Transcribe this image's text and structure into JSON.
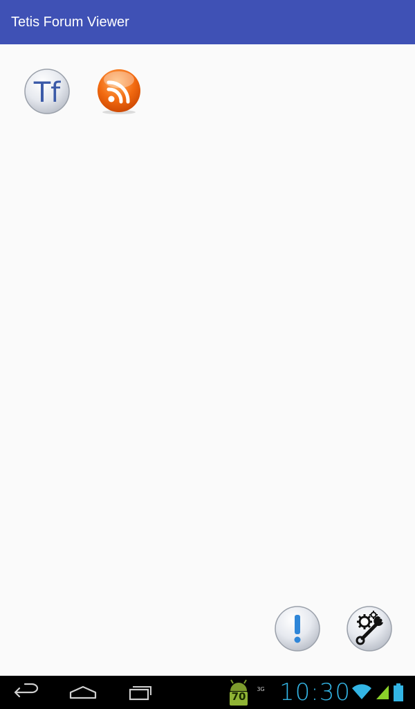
{
  "app_bar": {
    "title": "Tetis Forum Viewer",
    "color": "#3f51b5"
  },
  "main": {
    "buttons": [
      {
        "name": "tf-logo-button",
        "icon": "tf-logo-icon",
        "label": "Tf"
      },
      {
        "name": "rss-feed-button",
        "icon": "rss-icon"
      },
      {
        "name": "info-button",
        "icon": "exclamation-icon"
      },
      {
        "name": "settings-button",
        "icon": "wrench-gear-icon"
      }
    ]
  },
  "nav_bar": {
    "back_icon": "back-icon",
    "home_icon": "home-icon",
    "recent_icon": "recent-apps-icon"
  },
  "status_bar": {
    "notification_badge": "70",
    "network_type": "3G",
    "time": "10:30",
    "accent_color": "#33b5e5"
  }
}
